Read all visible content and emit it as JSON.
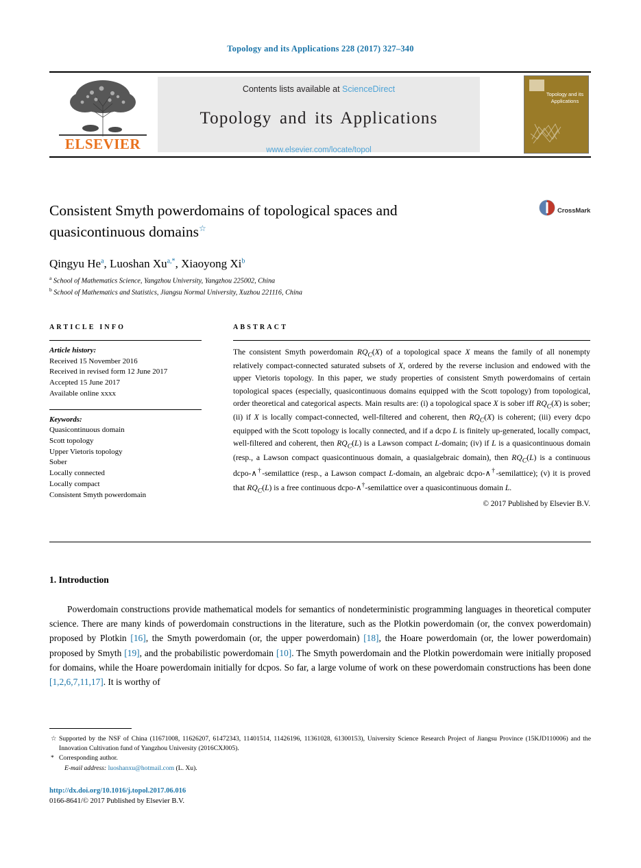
{
  "running_head": "Topology and its Applications 228 (2017) 327–340",
  "masthead": {
    "contents_label": "Contents lists available at",
    "sciencedirect": "ScienceDirect",
    "journal_name": "Topology and its Applications",
    "journal_url": "www.elsevier.com/locate/topol",
    "publisher": "ELSEVIER",
    "cover_title": "Topology and its Applications"
  },
  "article": {
    "title": "Consistent Smyth powerdomains of topological spaces and quasicontinuous domains",
    "title_footnote_mark": "☆",
    "authors": "Qingyu He, Luoshan Xu, Xiaoyong Xi",
    "affiliations": [
      {
        "mark": "a",
        "text": "School of Mathematics Science, Yangzhou University, Yangzhou 225002, China"
      },
      {
        "mark": "b",
        "text": "School of Mathematics and Statistics, Jiangsu Normal University, Xuzhou 221116, China"
      }
    ]
  },
  "crossmark": {
    "label": "CrossMark"
  },
  "info": {
    "heading": "ARTICLE INFO",
    "history_label": "Article history:",
    "history": [
      "Received 15 November 2016",
      "Received in revised form 12 June 2017",
      "Accepted 15 June 2017",
      "Available online xxxx"
    ],
    "keywords_label": "Keywords:",
    "keywords": [
      "Quasicontinuous domain",
      "Scott topology",
      "Upper Vietoris topology",
      "Sober",
      "Locally connected",
      "Locally compact",
      "Consistent Smyth powerdomain"
    ]
  },
  "abstract": {
    "heading": "ABSTRACT",
    "copyright": "© 2017 Published by Elsevier B.V."
  },
  "introduction": {
    "heading": "1. Introduction",
    "citations": {
      "plotkin": "[16]",
      "smyth_upper": "[18]",
      "smyth": "[19]",
      "probabilistic": "[10]",
      "volume": "[1,2,6,7,11,17]"
    }
  },
  "footnotes": {
    "funding_mark": "☆",
    "funding": "Supported by the NSF of China (11671008, 11626207, 61472343, 11401514, 11426196, 11361028, 61300153), University Science Research Project of Jiangsu Province (15KJD110006) and the Innovation Cultivation fund of Yangzhou University (2016CXJ005).",
    "corresponding_mark": "*",
    "corresponding": "Corresponding author.",
    "email_label": "E-mail address:",
    "email": "luoshanxu@hotmail.com",
    "email_owner": "(L. Xu)."
  },
  "footer": {
    "doi": "http://dx.doi.org/10.1016/j.topol.2017.06.016",
    "issn_line": "0166-8641/© 2017 Published by Elsevier B.V."
  },
  "colors": {
    "link": "#1a74a8",
    "sciencedirect": "#4ea3d6",
    "elsevier_orange": "#e9711c",
    "cover": "#9a7b28"
  }
}
